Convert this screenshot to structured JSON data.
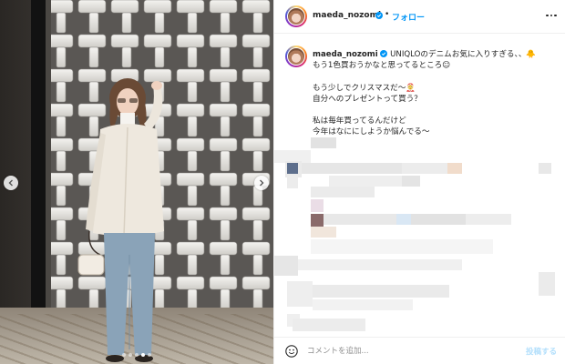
{
  "photo": {
    "prev_icon": "chevron-left-icon",
    "next_icon": "chevron-right-icon",
    "carousel_count": 5,
    "active_index": 3
  },
  "header": {
    "username": "maeda_nozomi",
    "verified_icon": "verified-badge-icon",
    "separator": "•",
    "follow_label": "フォロー",
    "more_icon": "more-options-icon"
  },
  "caption": {
    "username": "maeda_nozomi",
    "lines": "UNIQLOのデニムお気に入りすぎる、、🐥\nもう1色買おうかなと思ってるところ☺\n\nもう少しでクリスマスだ〜🤶\n自分へのプレゼントって買う？\n\n私は毎年買ってるんだけど\n今年はなににしようか悩んでる〜"
  },
  "footer": {
    "emoji_icon": "emoji-smiley-icon",
    "comment_placeholder": "コメントを追加...",
    "post_label": "投稿する"
  },
  "colors": {
    "accent_blue": "#0095f6",
    "post_disabled": "#b2dffc",
    "border": "#efefef"
  }
}
